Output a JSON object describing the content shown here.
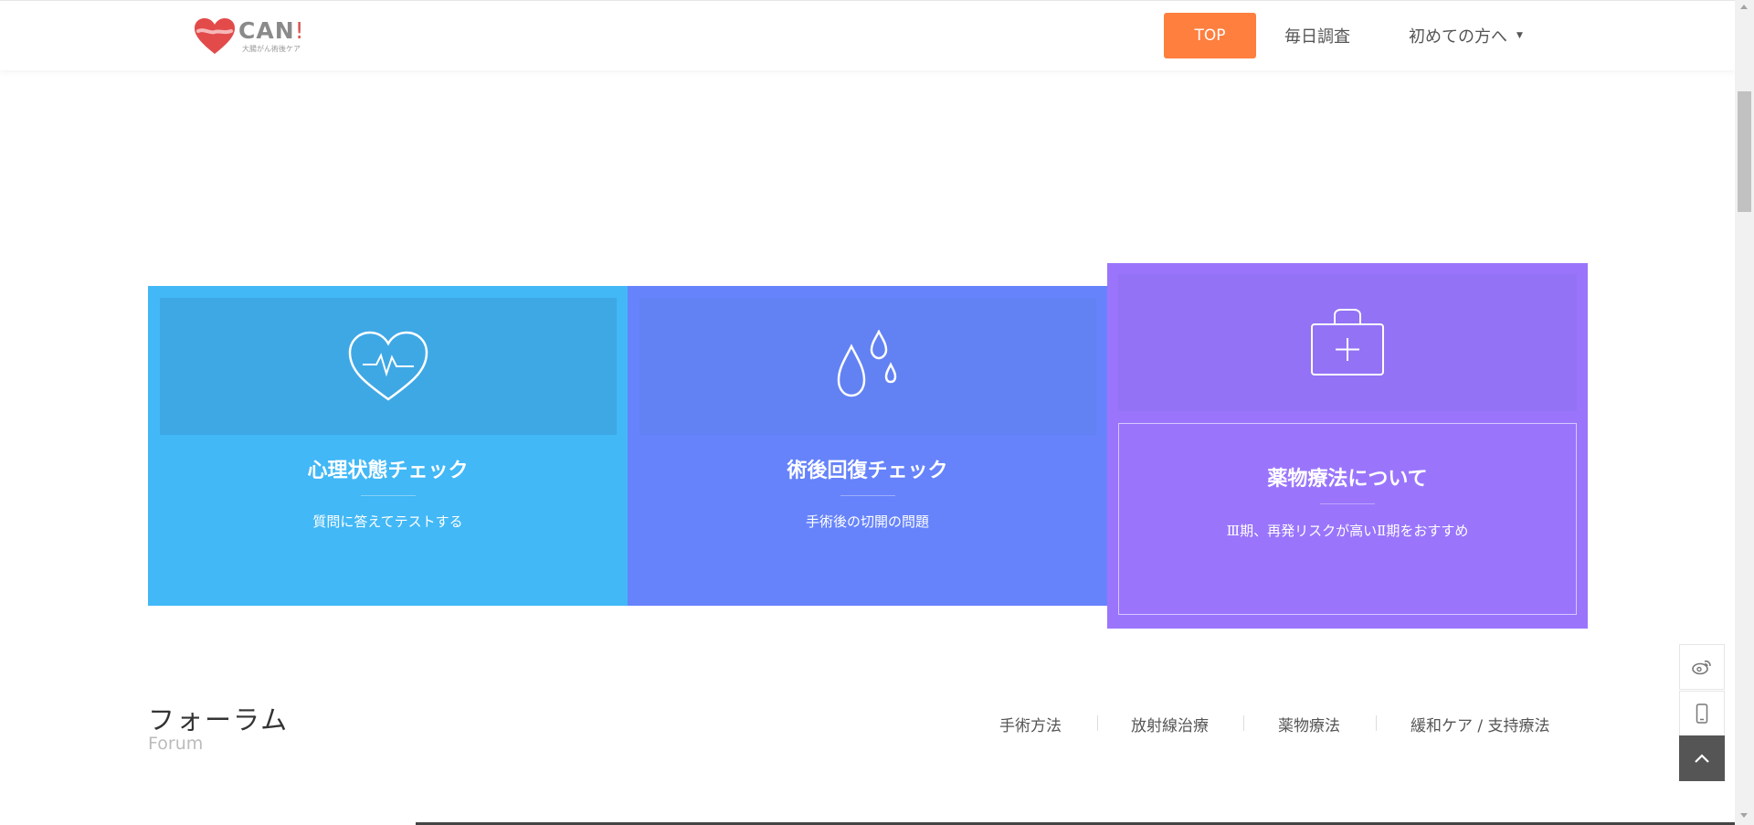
{
  "header": {
    "logo": {
      "text": "CAN",
      "mark": "!",
      "sub": "大腸がん術後ケア"
    },
    "nav": {
      "top": "TOP",
      "daily": "毎日調査",
      "first": "初めての方へ"
    }
  },
  "cards": [
    {
      "icon": "heart-pulse-icon",
      "title": "心理状態チェック",
      "subtitle": "質問に答えてテストする",
      "color": "#42b8f6"
    },
    {
      "icon": "water-drops-icon",
      "title": "術後回復チェック",
      "subtitle": "手術後の切開の問題",
      "color": "#6683fb"
    },
    {
      "icon": "medical-kit-icon",
      "title": "薬物療法について",
      "subtitle": "Ⅲ期、再発リスクが高いⅡ期をおすすめ",
      "color": "#9a75fc"
    }
  ],
  "forum": {
    "title": "フォーラム",
    "subtitle": "Forum",
    "tabs": [
      "手術方法",
      "放射線治療",
      "薬物療法",
      "緩和ケア / 支持療法"
    ]
  },
  "side_tools": {
    "weibo": "weibo-icon",
    "phone": "phone-icon",
    "back_top": "chevron-up-icon"
  },
  "colors": {
    "accent": "#ff7f3f",
    "card1": "#42b8f6",
    "card2": "#6683fb",
    "card3": "#9a75fc"
  }
}
